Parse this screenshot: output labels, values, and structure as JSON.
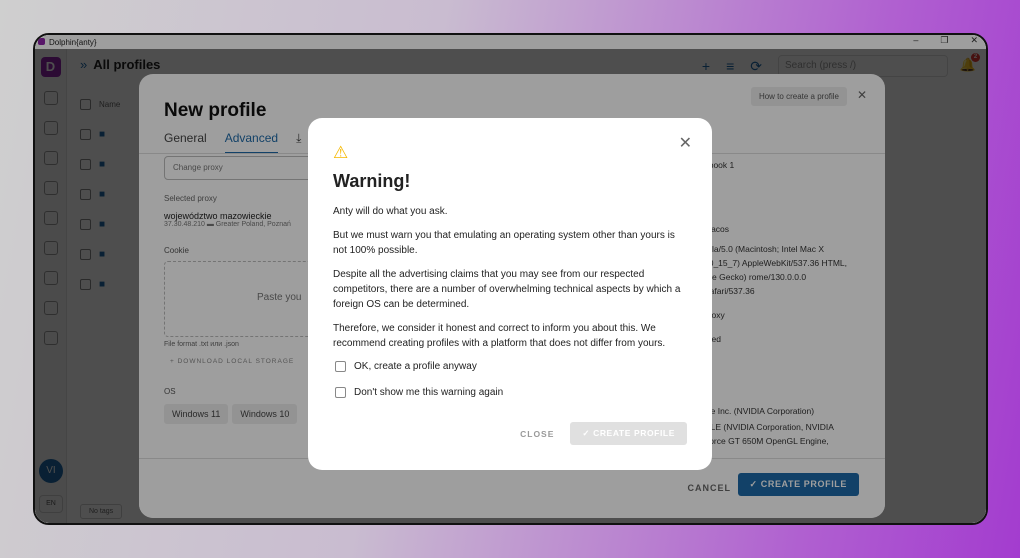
{
  "window": {
    "title": "Dolphin{anty}",
    "controls": [
      "–",
      "❐",
      "✕"
    ]
  },
  "app": {
    "brand": "D",
    "page_title": "All profiles",
    "search_placeholder": "Search (press /)",
    "notifications": "2",
    "list_header": "Name",
    "avatar": "VI",
    "lang": "EN",
    "footer_tags": [
      "No tags"
    ]
  },
  "new_profile": {
    "title": "New profile",
    "tabs": [
      "General",
      "Advanced"
    ],
    "help": "How to create a profile",
    "proxy_placeholder": "Change proxy",
    "selected_proxy_label": "Selected proxy",
    "proxy_name": "województwo mazowieckie",
    "proxy_ip": "37.30.48.210",
    "proxy_location": "Greater Poland, Poznań",
    "cookie_label": "Cookie",
    "cookie_placeholder": "Paste you",
    "file_format": "File format .txt или .json",
    "download_storage": "+ DOWNLOAD LOCAL STORAGE",
    "os_label": "OS",
    "os_options": [
      "Windows 11",
      "Windows 10"
    ],
    "right_values": [
      "ebook 1",
      "Macos",
      "zilla/5.0 (Macintosh; Intel Mac X 10_15_7) AppleWebKit/537.36 HTML, like Gecko) rome/130.0.0.0 Safari/537.36",
      "proxy",
      "ered",
      "al",
      "al",
      "gle Inc. (NVIDIA Corporation)",
      "GLE (NVIDIA Corporation, NVIDIA Force GT 650M OpenGL Engine,"
    ],
    "cancel": "CANCEL",
    "create": "✓ CREATE PROFILE"
  },
  "warning": {
    "title": "Warning!",
    "paragraphs": [
      "Anty will do what you ask.",
      "But we must warn you that emulating an operating system other than yours is not 100% possible.",
      "Despite all the advertising claims that you may see from our respected competitors, there are a number of overwhelming technical aspects by which a foreign OS can be determined.",
      "Therefore, we consider it honest and correct to inform you about this. We recommend creating profiles with a platform that does not differ from yours."
    ],
    "checkboxes": [
      "OK, create a profile anyway",
      "Don't show me this warning again"
    ],
    "close": "CLOSE",
    "create": "✓ CREATE PROFILE"
  }
}
